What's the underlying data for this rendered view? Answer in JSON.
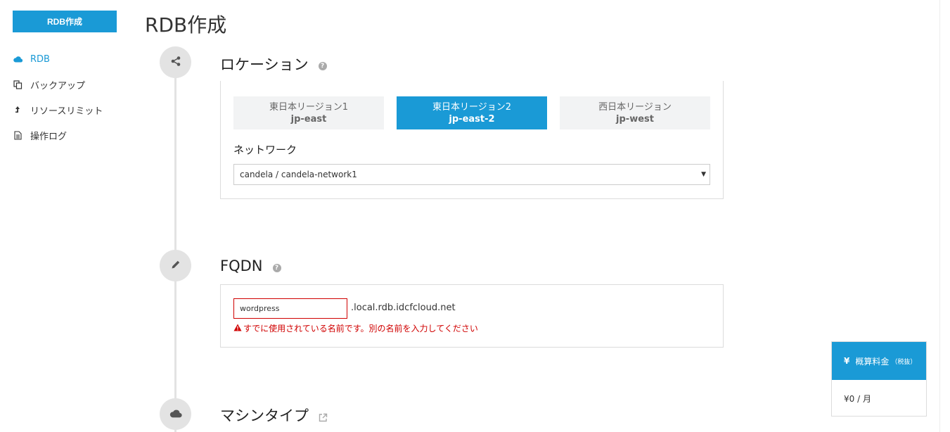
{
  "sidebar": {
    "create_button": "RDB作成",
    "items": [
      {
        "label": "RDB",
        "icon": "cloud-icon",
        "active": true
      },
      {
        "label": "バックアップ",
        "icon": "copy-icon"
      },
      {
        "label": "リソースリミット",
        "icon": "arrow-up-icon"
      },
      {
        "label": "操作ログ",
        "icon": "document-icon"
      }
    ]
  },
  "page": {
    "title": "RDB作成"
  },
  "location": {
    "title": "ロケーション",
    "regions": [
      {
        "name": "東日本リージョン1",
        "code": "jp-east",
        "selected": false
      },
      {
        "name": "東日本リージョン2",
        "code": "jp-east-2",
        "selected": true
      },
      {
        "name": "西日本リージョン",
        "code": "jp-west",
        "selected": false
      }
    ],
    "network_label": "ネットワーク",
    "network_value": "candela / candela-network1"
  },
  "fqdn": {
    "title": "FQDN",
    "input_value": "wordpress",
    "suffix": ".local.rdb.idcfcloud.net",
    "error": "すでに使用されている名前です。別の名前を入力してください"
  },
  "machine_type": {
    "title": "マシンタイプ"
  },
  "price": {
    "symbol": "¥",
    "label": "概算料金",
    "note": "（税抜）",
    "value": "¥0 / 月"
  },
  "colors": {
    "accent": "#1a9ad6",
    "error": "#d00000",
    "timeline": "#e3e3e3"
  }
}
